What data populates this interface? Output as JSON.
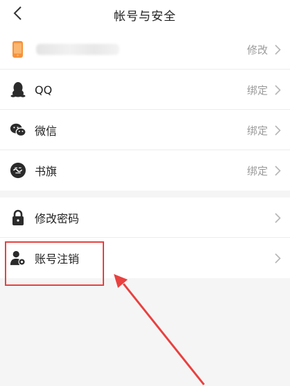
{
  "header": {
    "title": "帐号与安全"
  },
  "groups": {
    "bindings": [
      {
        "label": "",
        "value": "修改"
      },
      {
        "label": "QQ",
        "value": "绑定"
      },
      {
        "label": "微信",
        "value": "绑定"
      },
      {
        "label": "书旗",
        "value": "绑定"
      }
    ],
    "security": [
      {
        "label": "修改密码"
      },
      {
        "label": "账号注销"
      }
    ]
  },
  "colors": {
    "accent_orange": "#f6923a",
    "highlight_red": "#e8413f",
    "icon_dark": "#2b2b2b",
    "muted_text": "#9a9a9a"
  },
  "icons": [
    "back-chevron-icon",
    "phone-icon",
    "qq-penguin-icon",
    "wechat-icon",
    "shuqi-logo-icon",
    "lock-icon",
    "user-gear-icon",
    "chevron-right-icon"
  ]
}
